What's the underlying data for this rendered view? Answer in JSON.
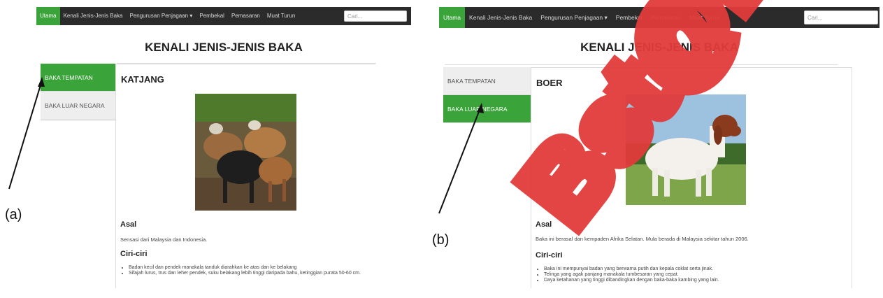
{
  "panel_a": {
    "nav": [
      "Utama",
      "Kenali Jenis-Jenis Baka",
      "Pengurusan Penjagaan ▾",
      "Pembekal",
      "Pemasaran",
      "Muat Turun"
    ],
    "search_placeholder": "Cari...",
    "page_title": "KENALI JENIS-JENIS BAKA",
    "sidebar": [
      "BAKA TEMPATAN",
      "BAKA LUAR NEGARA"
    ],
    "breed": "KATJANG",
    "asal_heading": "Asal",
    "asal_text": "Sensasi dari Malaysia dan Indonesia.",
    "ciri_heading": "Ciri-ciri",
    "traits": [
      "Badan kecil dan pendek manakala tanduk diarahkan ke atas dan ke belakang",
      "Sifajah lurus, trus dan leher pendek, suku belakang lebih tinggi daripada bahu, ketinggian purata 50-60 cm."
    ],
    "figure_label": "(a)"
  },
  "panel_b": {
    "nav": [
      "Utama",
      "Kenali Jenis-Jenis Baka",
      "Pengurusan Penjagaan ▾",
      "Pembekal",
      "Pemasaran",
      "Muat Turun"
    ],
    "search_placeholder": "Cari...",
    "page_title": "KENALI JENIS-JENIS BAKA",
    "sidebar": [
      "BAKA TEMPATAN",
      "BAKA LUAR NEGARA"
    ],
    "breed": "BOER",
    "asal_heading": "Asal",
    "asal_text": "Baka ini berasal dan kempaden Afrika Selatan. Mula berada di Malaysia sekitar tahun 2006.",
    "ciri_heading": "Ciri-ciri",
    "traits": [
      "Baka ini mempunyai badan yang berwarna putih dan kepala coklat serta jinak.",
      "Telinga yang agak panjang manakala tumbesaran yang cepat.",
      "Daya ketahanan yang tinggi dibandingkan dengan baka-baka kambing yang lain."
    ],
    "figure_label": "(b)"
  },
  "colors": {
    "nav_bg": "#2b2b2b",
    "accent_green": "#3aa33a",
    "watermark_red": "#e23b3b"
  },
  "watermark": "Bst@ETS"
}
